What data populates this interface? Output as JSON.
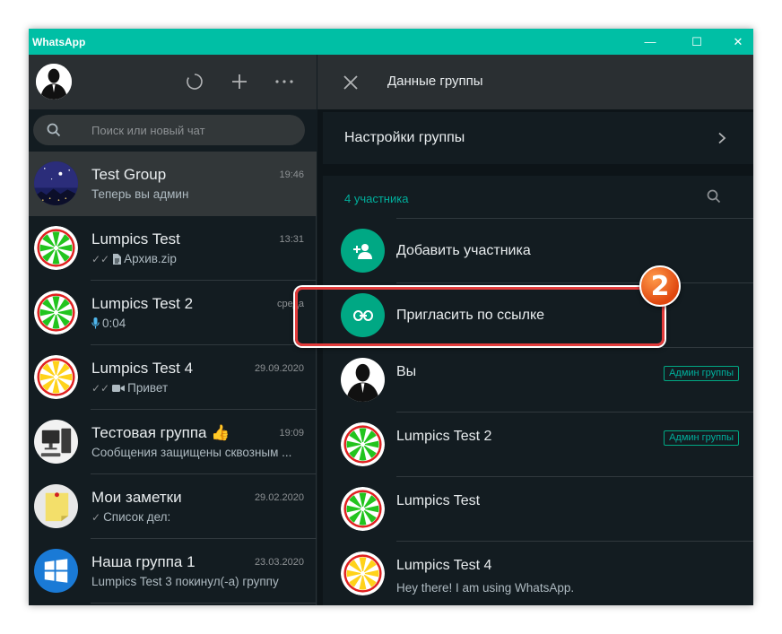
{
  "window": {
    "app_title": "WhatsApp",
    "controls": {
      "minimize": "—",
      "maximize": "☐",
      "close": "✕"
    }
  },
  "sidebar": {
    "search_placeholder": "Поиск или новый чат",
    "chats": [
      {
        "name": "Test Group",
        "time": "19:46",
        "preview": "Теперь вы админ",
        "avatar": "night-sky-avatar",
        "active": true
      },
      {
        "name": "Lumpics Test",
        "time": "13:31",
        "ticks": "✓✓",
        "preview": "Архив.zip",
        "avatar": "green-lime-avatar",
        "active": false
      },
      {
        "name": "Lumpics Test 2",
        "time": "среда",
        "preview": "0:04",
        "avatar": "green-lime-avatar",
        "active": false
      },
      {
        "name": "Lumpics Test 4",
        "time": "29.09.2020",
        "ticks": "✓✓",
        "preview": "Привет",
        "avatar": "yellow-lemon-avatar",
        "active": false
      },
      {
        "name": "Тестовая группа",
        "emoji": "👍",
        "time": "19:09",
        "preview": "Сообщения защищены сквозным ...",
        "avatar": "computer-avatar",
        "active": false
      },
      {
        "name": "Мои заметки",
        "time": "29.02.2020",
        "ticks": "✓",
        "preview": "Список дел:",
        "avatar": "sticky-note-avatar",
        "active": false
      },
      {
        "name": "Наша группа 1",
        "time": "23.03.2020",
        "preview": "Lumpics Test 3 покинул(-а) группу",
        "avatar": "windows-logo-avatar",
        "active": false
      }
    ]
  },
  "panel": {
    "title": "Данные группы",
    "settings_label": "Настройки группы",
    "members_count": "4 участника",
    "add_member_label": "Добавить участника",
    "invite_link_label": "Пригласить по ссылке",
    "members": [
      {
        "name": "Вы",
        "badge": "Админ группы",
        "status": "",
        "avatar": "silhouette-avatar"
      },
      {
        "name": "Lumpics Test 2",
        "badge": "Админ группы",
        "status": "",
        "avatar": "green-lime-avatar"
      },
      {
        "name": "Lumpics Test",
        "badge": "",
        "status": "",
        "avatar": "green-lime-avatar"
      },
      {
        "name": "Lumpics Test 4",
        "badge": "",
        "status": "Hey there! I am using WhatsApp.",
        "avatar": "yellow-lemon-avatar"
      }
    ]
  },
  "annotation": {
    "step_number": "2",
    "color": "#e23b3b"
  },
  "colors": {
    "accent": "#00a884",
    "titlebar": "#00bfa5",
    "background": "#131c21",
    "header": "#2a2f32"
  }
}
